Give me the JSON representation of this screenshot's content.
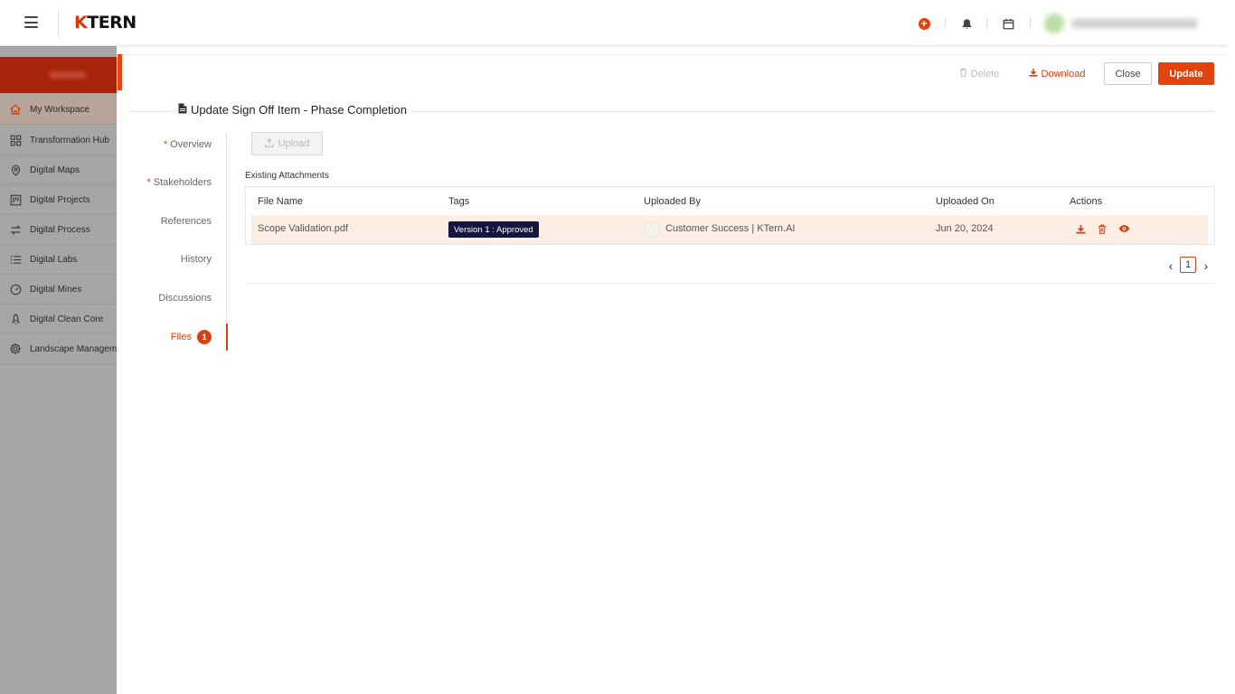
{
  "header": {
    "logo_k": "K",
    "logo_rest": "TERN",
    "icons": [
      "hamburger-icon",
      "plus-circle-icon",
      "bell-icon",
      "calendar-icon"
    ]
  },
  "sidebar": {
    "items": [
      {
        "label": "My Workspace",
        "icon": "home-icon",
        "active": true
      },
      {
        "label": "Transformation Hub",
        "icon": "grid-icon"
      },
      {
        "label": "Digital Maps",
        "icon": "map-pin-icon"
      },
      {
        "label": "Digital Projects",
        "icon": "kanban-icon"
      },
      {
        "label": "Digital Process",
        "icon": "arrows-icon"
      },
      {
        "label": "Digital Labs",
        "icon": "list-icon"
      },
      {
        "label": "Digital Mines",
        "icon": "gauge-icon"
      },
      {
        "label": "Digital Clean Core",
        "icon": "rocket-icon"
      },
      {
        "label": "Landscape Management",
        "icon": "gear-icon"
      }
    ]
  },
  "toolbar": {
    "delete_label": "Delete",
    "download_label": "Download",
    "close_label": "Close",
    "update_label": "Update"
  },
  "page": {
    "title": "Update Sign Off Item - Phase Completion"
  },
  "tabs": [
    {
      "label": "Overview",
      "required": true
    },
    {
      "label": "Stakeholders",
      "required": true
    },
    {
      "label": "References"
    },
    {
      "label": "History"
    },
    {
      "label": "Discussions"
    },
    {
      "label": "Files",
      "active": true,
      "badge": "1"
    }
  ],
  "files": {
    "upload_label": "Upload",
    "section_label": "Existing Attachments",
    "columns": [
      "File Name",
      "Tags",
      "Uploaded By",
      "Uploaded On",
      "Actions"
    ],
    "rows": [
      {
        "file_name": "Scope Validation.pdf",
        "tag": "Version 1 : Approved",
        "uploaded_by": "Customer Success | KTern.AI",
        "uploaded_on": "Jun 20, 2024",
        "actions": [
          "download-icon",
          "trash-icon",
          "eye-icon"
        ]
      }
    ],
    "pagination": {
      "current_page": "1"
    }
  },
  "colors": {
    "accent": "#e2430f",
    "tag_bg": "#141540",
    "row_highlight": "#fdeee5"
  }
}
